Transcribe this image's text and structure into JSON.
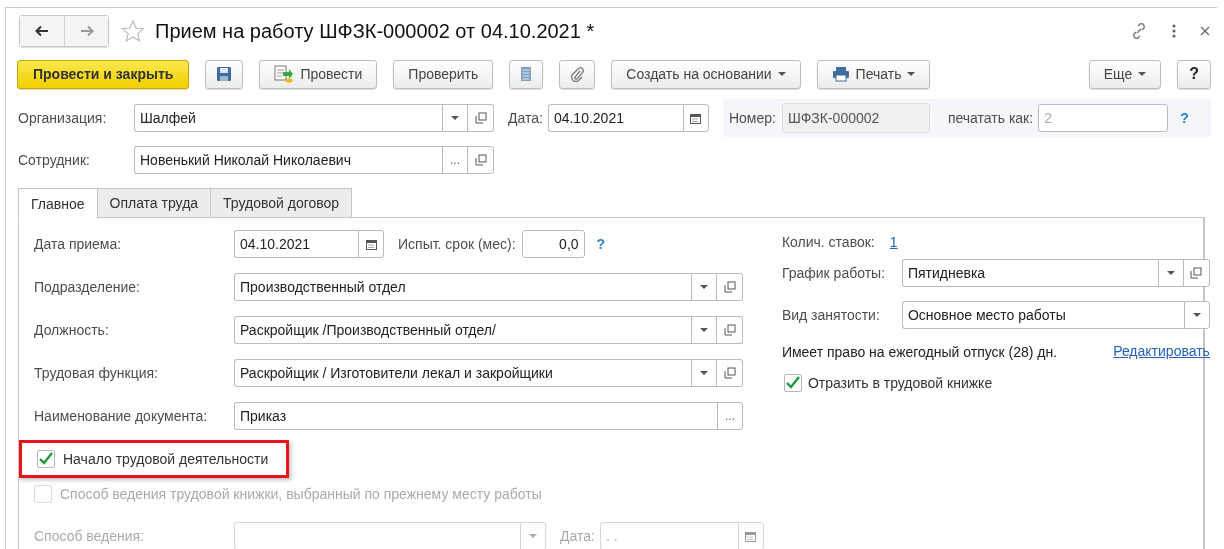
{
  "window": {
    "title": "Прием на работу ШФЗК-000002 от 04.10.2021 *",
    "favorite": false
  },
  "toolbar": {
    "buttons": [
      {
        "label": "Провести и закрыть",
        "kind": "primary"
      },
      {
        "kind": "save"
      },
      {
        "label": "Провести",
        "kind": "post"
      },
      {
        "label": "Проверить",
        "kind": "plain"
      },
      {
        "kind": "list"
      },
      {
        "kind": "attach"
      },
      {
        "label": "Создать на основании",
        "kind": "menu"
      },
      {
        "label": "Печать",
        "kind": "print"
      }
    ],
    "right_buttons": [
      {
        "label": "Еще",
        "kind": "menu"
      },
      {
        "label": "?",
        "kind": "help"
      }
    ]
  },
  "header": {
    "organization": {
      "label": "Организация:",
      "value": "Шалфей"
    },
    "date": {
      "label": "Дата:",
      "value": "04.10.2021"
    },
    "number": {
      "label": "Номер:",
      "value": "ШФЗК-000002"
    },
    "print_as": {
      "label": "печатать как:",
      "placeholder": "2"
    },
    "help": "?",
    "employee": {
      "label": "Сотрудник:",
      "value": "Новенький Николай Николаевич",
      "choose": "..."
    }
  },
  "tabs": [
    {
      "label": "Главное",
      "selected": true
    },
    {
      "label": "Оплата труда",
      "selected": false
    },
    {
      "label": "Трудовой договор",
      "selected": false
    }
  ],
  "main": {
    "hire_date": {
      "label": "Дата приема:",
      "value": "04.10.2021"
    },
    "probation": {
      "label": "Испыт. срок (мес):",
      "value": "0,0",
      "help": "?"
    },
    "fields": [
      {
        "label": "Подразделение:",
        "value": "Производственный отдел",
        "kind": "select"
      },
      {
        "label": "Должность:",
        "value": "Раскройщик /Производственный отдел/",
        "kind": "select"
      },
      {
        "label": "Трудовая функция:",
        "value": "Раскройщик / Изготовители лекал и закройщики",
        "kind": "select"
      },
      {
        "label": "Наименование документа:",
        "value": "Приказ",
        "kind": "choice",
        "choose": "..."
      }
    ],
    "start_of_work": {
      "label": "Начало трудовой деятельности",
      "checked": true,
      "highlighted": true
    },
    "previous_method": {
      "label": "Способ ведения трудовой книжки, выбранный по прежнему месту работы",
      "checked": false,
      "disabled": true
    },
    "method": {
      "label": "Способ ведения:",
      "disabled": true
    },
    "method_date": {
      "label": "Дата:",
      "placeholder": ". .",
      "disabled": true
    }
  },
  "side": {
    "rates": {
      "label": "Колич. ставок:",
      "value": "1"
    },
    "schedule": {
      "label": "График работы:",
      "value": "Пятидневка"
    },
    "employment": {
      "label": "Вид занятости:",
      "value": "Основное место работы"
    },
    "vacation": {
      "text": "Имеет право на ежегодный отпуск (28) дн.",
      "link": "Редактировать"
    },
    "record_book": {
      "label": "Отразить в трудовой книжке",
      "checked": true
    }
  }
}
